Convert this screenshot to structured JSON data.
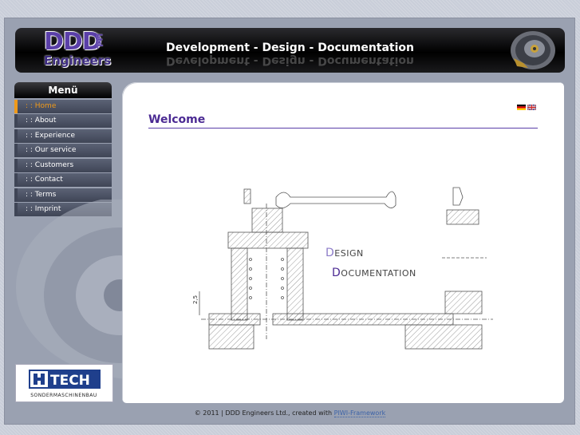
{
  "header": {
    "logo_main": "DDD",
    "logo_ltd": "Ltd.",
    "logo_sub": "Engineers",
    "tagline": "Development - Design - Documentation"
  },
  "menu": {
    "title": "Menü",
    "items": [
      {
        "label": ": : Home",
        "active": true
      },
      {
        "label": ": : About"
      },
      {
        "label": ": : Experience"
      },
      {
        "label": ": : Our service"
      },
      {
        "label": ": : Customers"
      },
      {
        "label": ": : Contact"
      },
      {
        "label": ": : Terms"
      },
      {
        "label": ": : Imprint"
      }
    ]
  },
  "content": {
    "heading": "Welcome",
    "label_design_cap": "D",
    "label_design_rest": "ESIGN",
    "label_doc_cap": "D",
    "label_doc_rest": "OCUMENTATION",
    "dimension_label": "2,5"
  },
  "languages": [
    "de",
    "en"
  ],
  "partner": {
    "name": "TECH",
    "sub": "SONDERMASCHINENBAU"
  },
  "footer": {
    "text": "© 2011 | DDD Engineers Ltd., created with ",
    "link": "PIWI-Framework"
  },
  "colors": {
    "accent": "#f09a1a",
    "brand": "#4b2a93",
    "menu_bg": "#4a5063"
  }
}
